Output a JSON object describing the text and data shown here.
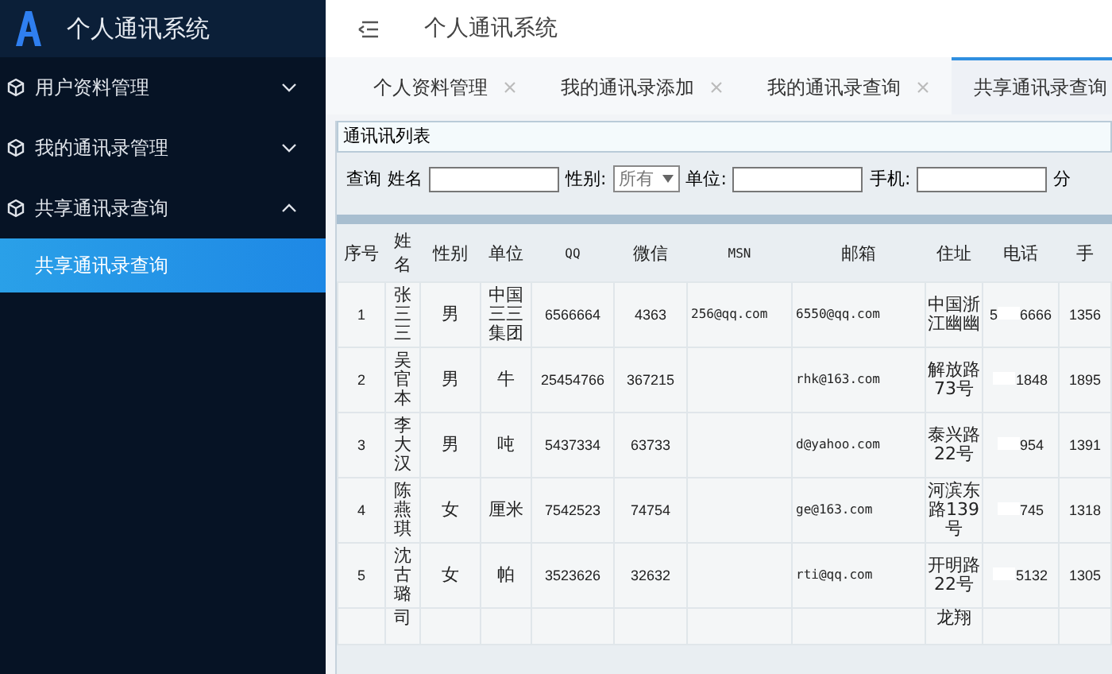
{
  "app": {
    "title": "个人通讯系统"
  },
  "sidebar": {
    "items": [
      {
        "label": "用户资料管理",
        "expanded": false
      },
      {
        "label": "我的通讯录管理",
        "expanded": false
      },
      {
        "label": "共享通讯录查询",
        "expanded": true,
        "children": [
          {
            "label": "共享通讯录查询",
            "selected": true
          }
        ]
      }
    ]
  },
  "header": {
    "title": "个人通讯系统"
  },
  "tabs": [
    {
      "label": "个人资料管理",
      "selected": false,
      "closable": true
    },
    {
      "label": "我的通讯录添加",
      "selected": false,
      "closable": true
    },
    {
      "label": "我的通讯录查询",
      "selected": false,
      "closable": true
    },
    {
      "label": "共享通讯录查询",
      "selected": true,
      "closable": false
    }
  ],
  "panel": {
    "title": "通讯讯列表",
    "query": {
      "label": "查询",
      "fields": [
        {
          "kind": "text",
          "label": "姓名"
        },
        {
          "kind": "select",
          "label": "性别:",
          "value": "所有"
        },
        {
          "kind": "text",
          "label": "单位:"
        },
        {
          "kind": "text",
          "label": "手机:"
        },
        {
          "kind": "cut",
          "label": "分"
        }
      ]
    },
    "table": {
      "columns": [
        "序号",
        "姓名",
        "性别",
        "单位",
        "QQ",
        "微信",
        "MSN",
        "邮箱",
        "住址",
        "电话",
        "手"
      ],
      "rows": [
        {
          "cells": [
            "1",
            "张三三",
            "男",
            "中国三三集团",
            "6566664",
            "4363",
            "256@qq.com",
            "6550@qq.com",
            "中国浙江幽幽",
            "5",
            "1356"
          ],
          "phone_tail": "6666"
        },
        {
          "cells": [
            "2",
            "吴官本",
            "男",
            "牛",
            "25454766",
            "367215",
            null,
            "rhk@163.com",
            "解放路73号",
            null,
            "1895"
          ],
          "phone_tail": "1848"
        },
        {
          "cells": [
            "3",
            "李大汉",
            "男",
            "吨",
            "5437334",
            "63733",
            null,
            "d@yahoo.com",
            "泰兴路22号",
            null,
            "1391"
          ],
          "phone_tail": "954"
        },
        {
          "cells": [
            "4",
            "陈燕琪",
            "女",
            "厘米",
            "7542523",
            "74754",
            null,
            "ge@163.com",
            "河滨东路139号",
            null,
            "1318"
          ],
          "phone_tail": "745"
        },
        {
          "cells": [
            "5",
            "沈古璐",
            "女",
            "帕",
            "3523626",
            "32632",
            null,
            "rti@qq.com",
            "开明路22号",
            null,
            "1305"
          ],
          "phone_tail": "5132"
        },
        {
          "cells": [
            null,
            "司",
            null,
            null,
            null,
            null,
            null,
            null,
            "龙翔",
            null,
            null
          ]
        }
      ]
    }
  }
}
